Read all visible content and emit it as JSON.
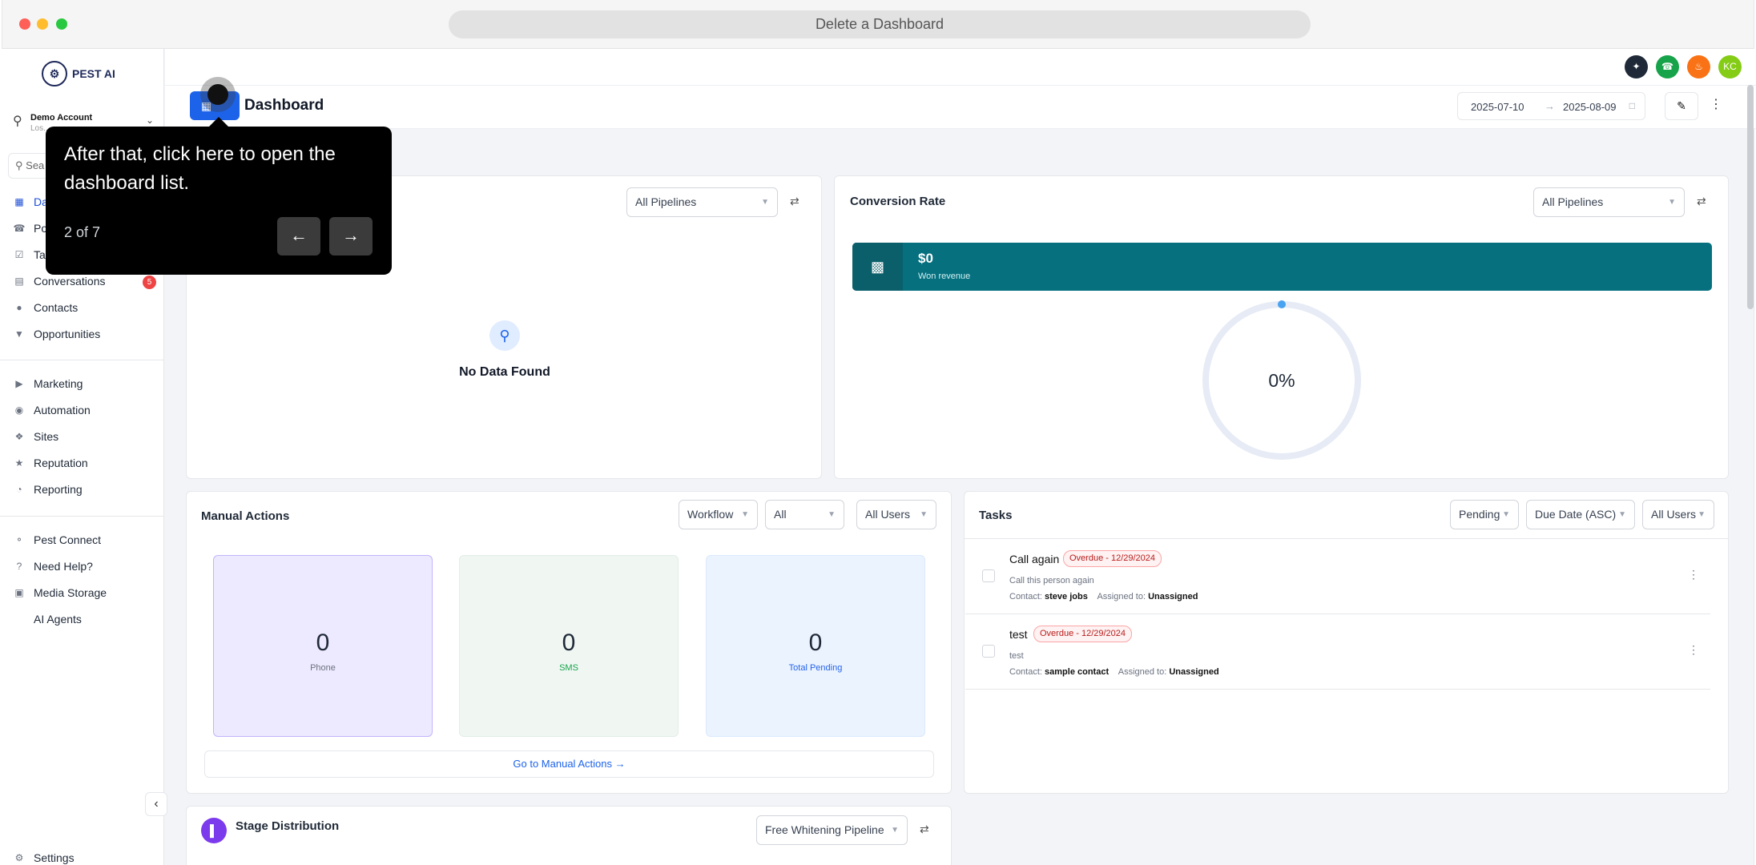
{
  "window": {
    "url_title": "Delete a Dashboard"
  },
  "sidebar": {
    "logo_text": "PEST AI",
    "account_name": "Demo Account",
    "account_sub": "Los...",
    "search_placeholder": "Sea",
    "items_main": [
      {
        "label": "Da",
        "icon": "dashboard-icon"
      },
      {
        "label": "Po",
        "icon": "phone-icon"
      },
      {
        "label": "Ta",
        "icon": "task-icon"
      },
      {
        "label": "Conversations",
        "icon": "chat-icon",
        "badge": "5"
      },
      {
        "label": "Contacts",
        "icon": "person-icon"
      },
      {
        "label": "Opportunities",
        "icon": "funnel-icon"
      }
    ],
    "items_marketing": [
      {
        "label": "Marketing",
        "icon": "megaphone-icon"
      },
      {
        "label": "Automation",
        "icon": "automation-icon"
      },
      {
        "label": "Sites",
        "icon": "sites-icon"
      },
      {
        "label": "Reputation",
        "icon": "star-icon"
      },
      {
        "label": "Reporting",
        "icon": "pie-icon"
      }
    ],
    "items_tools": [
      {
        "label": "Pest Connect",
        "icon": "connect-icon"
      },
      {
        "label": "Need Help?",
        "icon": "help-icon"
      },
      {
        "label": "Media Storage",
        "icon": "image-icon"
      },
      {
        "label": "AI Agents",
        "icon": ""
      }
    ],
    "settings_label": "Settings"
  },
  "topbar": {
    "avatar_initials": "KC",
    "icon_colors": {
      "magic": "#1f2937",
      "phone": "#16a34a",
      "bell": "#f97316",
      "avatar": "#84cc16"
    }
  },
  "header": {
    "title": "Dashboard",
    "date_start": "2025-07-10",
    "date_end": "2025-08-09"
  },
  "cards": {
    "pipeline_card": {
      "select": "All Pipelines",
      "empty_text": "No Data Found"
    },
    "conversion": {
      "title": "Conversion Rate",
      "select": "All Pipelines",
      "revenue_value": "$0",
      "revenue_label": "Won revenue",
      "rate": "0%"
    },
    "manual_actions": {
      "title": "Manual Actions",
      "filters": [
        "Workflow",
        "All",
        "All Users"
      ],
      "stats": [
        {
          "value": "0",
          "label": "Phone"
        },
        {
          "value": "0",
          "label": "SMS"
        },
        {
          "value": "0",
          "label": "Total Pending"
        }
      ],
      "link": "Go to Manual Actions"
    },
    "tasks": {
      "title": "Tasks",
      "filters": [
        "Pending",
        "Due Date (ASC)",
        "All Users"
      ],
      "items": [
        {
          "title": "Call again",
          "badge": "Overdue - 12/29/2024",
          "desc": "Call this person again",
          "contact_label": "Contact:",
          "contact": "steve jobs",
          "assigned_label": "Assigned to:",
          "assigned": "Unassigned"
        },
        {
          "title": "test",
          "badge": "Overdue - 12/29/2024",
          "desc": "test",
          "contact_label": "Contact:",
          "contact": "sample contact",
          "assigned_label": "Assigned to:",
          "assigned": "Unassigned"
        }
      ]
    },
    "stage": {
      "title": "Stage Distribution",
      "select": "Free Whitening Pipeline"
    }
  },
  "tooltip": {
    "message": "After that, click here to open the dashboard list.",
    "step": "2 of 7"
  }
}
